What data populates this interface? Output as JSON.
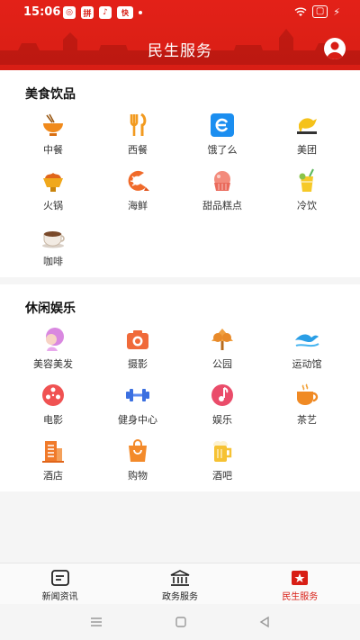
{
  "status_bar": {
    "time": "15:06",
    "apps": [
      "◎",
      "拼",
      "♪",
      "快"
    ],
    "wifi": "WiFi",
    "battery": "⚡"
  },
  "header": {
    "title": "民生服务"
  },
  "sections": [
    {
      "title": "美食饮品",
      "items": [
        {
          "label": "中餐",
          "icon": "noodle-bowl-icon"
        },
        {
          "label": "西餐",
          "icon": "fork-knife-icon"
        },
        {
          "label": "饿了么",
          "icon": "eleme-logo-icon"
        },
        {
          "label": "美团",
          "icon": "meituan-kangaroo-icon"
        },
        {
          "label": "火锅",
          "icon": "hotpot-icon"
        },
        {
          "label": "海鲜",
          "icon": "shrimp-icon"
        },
        {
          "label": "甜品糕点",
          "icon": "cake-icon"
        },
        {
          "label": "冷饮",
          "icon": "cold-drink-icon"
        },
        {
          "label": "咖啡",
          "icon": "coffee-cup-icon"
        }
      ]
    },
    {
      "title": "休闲娱乐",
      "items": [
        {
          "label": "美容美发",
          "icon": "beauty-hair-icon"
        },
        {
          "label": "摄影",
          "icon": "camera-icon"
        },
        {
          "label": "公园",
          "icon": "tree-icon"
        },
        {
          "label": "运动馆",
          "icon": "wave-icon"
        },
        {
          "label": "电影",
          "icon": "film-reel-icon"
        },
        {
          "label": "健身中心",
          "icon": "dumbbell-icon"
        },
        {
          "label": "娱乐",
          "icon": "music-note-icon"
        },
        {
          "label": "茶艺",
          "icon": "tea-cup-icon"
        },
        {
          "label": "酒店",
          "icon": "hotel-building-icon"
        },
        {
          "label": "购物",
          "icon": "shopping-bag-icon"
        },
        {
          "label": "酒吧",
          "icon": "beer-mug-icon"
        }
      ]
    }
  ],
  "tabbar": [
    {
      "label": "新闻资讯",
      "icon": "news-icon",
      "active": false
    },
    {
      "label": "政务服务",
      "icon": "government-building-icon",
      "active": false
    },
    {
      "label": "民生服务",
      "icon": "people-service-icon",
      "active": true
    }
  ],
  "colors": {
    "brand_red": "#d81e15",
    "text": "#333333"
  }
}
